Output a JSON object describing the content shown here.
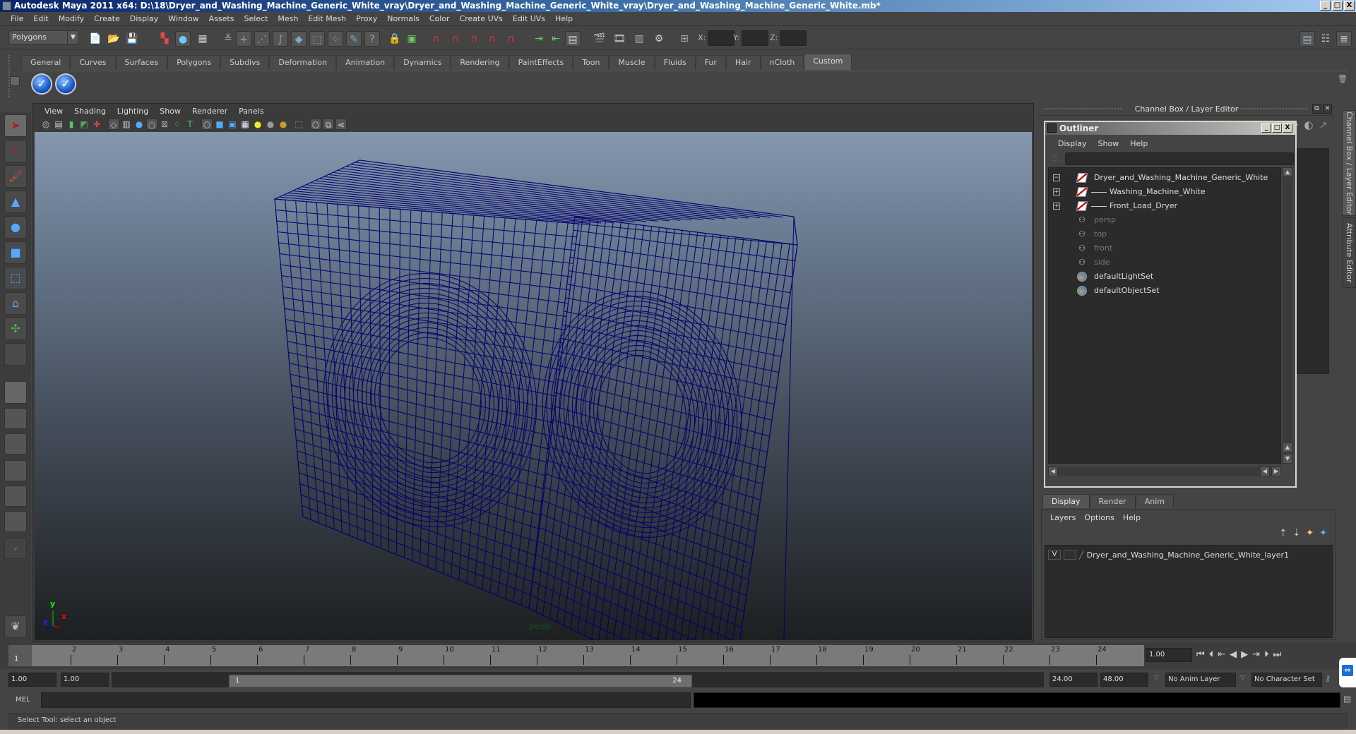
{
  "window": {
    "title": "Autodesk Maya 2011 x64: D:\\18\\Dryer_and_Washing_Machine_Generic_White_vray\\Dryer_and_Washing_Machine_Generic_White_vray\\Dryer_and_Washing_Machine_Generic_White.mb*",
    "buttons": [
      "_",
      "□",
      "X"
    ]
  },
  "menubar": [
    "File",
    "Edit",
    "Modify",
    "Create",
    "Display",
    "Window",
    "Assets",
    "Select",
    "Mesh",
    "Edit Mesh",
    "Proxy",
    "Normals",
    "Color",
    "Create UVs",
    "Edit UVs",
    "Help"
  ],
  "toolbar": {
    "menuset": "Polygons",
    "x_label": "X:",
    "y_label": "Y:",
    "z_label": "Z:",
    "icons": [
      "new-scene",
      "open-scene",
      "save-scene",
      "select-by-hierarchy",
      "select-by-object",
      "select-by-component",
      "snap-grid",
      "snap-curve",
      "snap-point",
      "snap-view-plane",
      "make-live",
      "input-ops",
      "output-ops",
      "construction-history",
      "render-current-frame",
      "ipr-render",
      "render-settings"
    ]
  },
  "shelf": {
    "tabs": [
      "General",
      "Curves",
      "Surfaces",
      "Polygons",
      "Subdivs",
      "Deformation",
      "Animation",
      "Dynamics",
      "Rendering",
      "PaintEffects",
      "Toon",
      "Muscle",
      "Fluids",
      "Fur",
      "Hair",
      "nCloth",
      "Custom"
    ],
    "active_tab": "Custom",
    "icons": [
      "check-icon",
      "check-icon"
    ]
  },
  "toolbox": [
    "select-tool",
    "lasso-tool",
    "paint-select-tool",
    "move-tool",
    "rotate-tool",
    "scale-tool",
    "universal-manip-tool",
    "soft-mod-tool",
    "show-manipulator-tool",
    "last-tool"
  ],
  "viewport": {
    "menu": [
      "View",
      "Shading",
      "Lighting",
      "Show",
      "Renderer",
      "Panels"
    ],
    "camera_label": "persp",
    "axis": {
      "x": "x",
      "y": "y",
      "z": "z"
    },
    "wire_color": "#00006e"
  },
  "channel_box": {
    "title": "Channel Box / Layer Editor",
    "side_tabs": [
      "Channel Box / Layer Editor",
      "Attribute Editor"
    ]
  },
  "outliner": {
    "title": "Outliner",
    "menu": [
      "Display",
      "Show",
      "Help"
    ],
    "items": [
      {
        "label": "Dryer_and_Washing_Machine_Generic_White",
        "type": "transform",
        "expander": "−",
        "indent": 0,
        "dim": false
      },
      {
        "label": "Washing_Machine_White",
        "type": "transform",
        "expander": "+",
        "indent": 1,
        "dim": false
      },
      {
        "label": "Front_Load_Dryer",
        "type": "transform",
        "expander": "+",
        "indent": 1,
        "dim": false
      },
      {
        "label": "persp",
        "type": "camera",
        "expander": "",
        "indent": 0,
        "dim": true
      },
      {
        "label": "top",
        "type": "camera",
        "expander": "",
        "indent": 0,
        "dim": true
      },
      {
        "label": "front",
        "type": "camera",
        "expander": "",
        "indent": 0,
        "dim": true
      },
      {
        "label": "side",
        "type": "camera",
        "expander": "",
        "indent": 0,
        "dim": true
      },
      {
        "label": "defaultLightSet",
        "type": "set",
        "expander": "",
        "indent": 0,
        "dim": false
      },
      {
        "label": "defaultObjectSet",
        "type": "set",
        "expander": "",
        "indent": 0,
        "dim": false
      }
    ]
  },
  "layer_editor": {
    "tabs": [
      "Display",
      "Render",
      "Anim"
    ],
    "active_tab": "Display",
    "menu": [
      "Layers",
      "Options",
      "Help"
    ],
    "layers": [
      {
        "visible": "V",
        "name": "Dryer_and_Washing_Machine_Generic_White_layer1"
      }
    ]
  },
  "time_slider": {
    "ticks": [
      "1",
      "2",
      "3",
      "4",
      "5",
      "6",
      "7",
      "8",
      "9",
      "10",
      "11",
      "12",
      "13",
      "14",
      "15",
      "16",
      "17",
      "18",
      "19",
      "20",
      "21",
      "22",
      "23",
      "24"
    ],
    "current_frame_label": "1",
    "current_time": "1.00"
  },
  "range_slider": {
    "start_time": "1.00",
    "playback_start": "1.00",
    "range_start_label": "1",
    "range_end_label": "24",
    "playback_end": "24.00",
    "end_time": "48.00",
    "anim_layer": "No Anim Layer",
    "character_set": "No Character Set"
  },
  "command_line": {
    "label": "MEL",
    "value": ""
  },
  "status": {
    "text": "Select Tool: select an object"
  }
}
